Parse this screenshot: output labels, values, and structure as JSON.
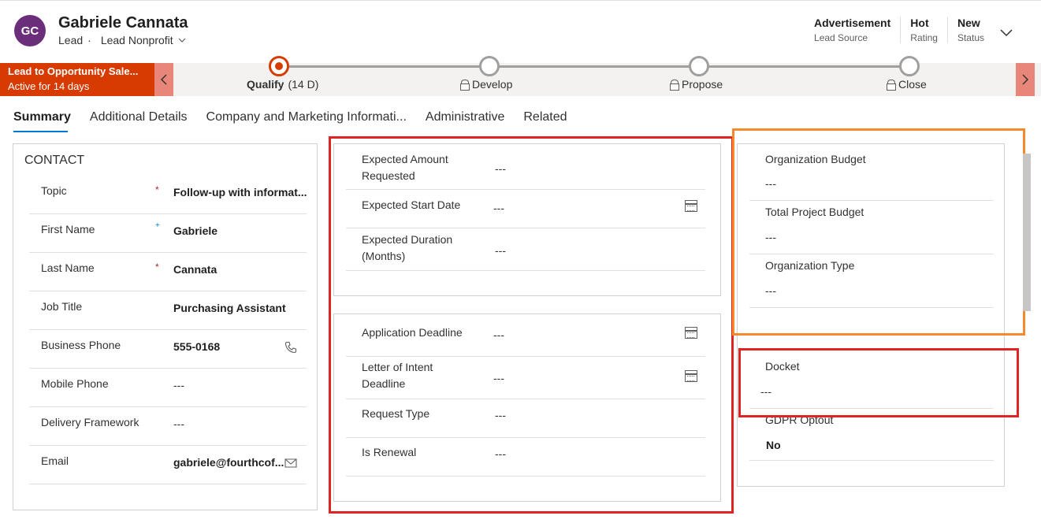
{
  "header": {
    "avatar_initials": "GC",
    "record_name": "Gabriele Cannata",
    "entity": "Lead",
    "separator": "·",
    "form_name": "Lead Nonprofit",
    "fields": [
      {
        "value": "Advertisement",
        "label": "Lead Source"
      },
      {
        "value": "Hot",
        "label": "Rating"
      },
      {
        "value": "New",
        "label": "Status"
      }
    ]
  },
  "bpf": {
    "process_name": "Lead to Opportunity Sale...",
    "active_for": "Active for 14 days",
    "stages": [
      {
        "label": "Qualify",
        "duration": "(14 D)",
        "active": true,
        "locked": false
      },
      {
        "label": "Develop",
        "active": false,
        "locked": true
      },
      {
        "label": "Propose",
        "active": false,
        "locked": true
      },
      {
        "label": "Close",
        "active": false,
        "locked": true
      }
    ],
    "accent_color": "#d83b01"
  },
  "tabs": [
    "Summary",
    "Additional Details",
    "Company and Marketing Informati...",
    "Administrative",
    "Related"
  ],
  "contact": {
    "title": "CONTACT",
    "fields": [
      {
        "label": "Topic",
        "value": "Follow-up with informat...",
        "required": "*"
      },
      {
        "label": "First Name",
        "value": "Gabriele",
        "required": "+"
      },
      {
        "label": "Last Name",
        "value": "Cannata",
        "required": "*"
      },
      {
        "label": "Job Title",
        "value": "Purchasing Assistant",
        "required": ""
      },
      {
        "label": "Business Phone",
        "value": "555-0168",
        "required": ""
      },
      {
        "label": "Mobile Phone",
        "value": "---",
        "required": ""
      },
      {
        "label": "Delivery Framework",
        "value": "---",
        "required": ""
      },
      {
        "label": "Email",
        "value": "gabriele@fourthcof...",
        "required": ""
      }
    ]
  },
  "funding": {
    "fields": [
      {
        "label": "Expected Amount Requested",
        "value": "---"
      },
      {
        "label": "Expected Start Date",
        "value": "---"
      },
      {
        "label": "Expected Duration (Months)",
        "value": "---"
      }
    ]
  },
  "application": {
    "fields": [
      {
        "label": "Application Deadline",
        "value": "---"
      },
      {
        "label": "Letter of Intent Deadline",
        "value": "---"
      },
      {
        "label": "Request Type",
        "value": "---"
      },
      {
        "label": "Is Renewal",
        "value": "---"
      }
    ]
  },
  "organization": {
    "fields": [
      {
        "label": "Organization Budget",
        "value": "---"
      },
      {
        "label": "Total Project Budget",
        "value": "---"
      },
      {
        "label": "Organization Type",
        "value": "---"
      }
    ]
  },
  "other": {
    "fields": [
      {
        "label": "Docket",
        "value": "---"
      },
      {
        "label": "GDPR Optout",
        "value": "No"
      }
    ]
  },
  "highlight_colors": {
    "red": "#e02323",
    "orange": "#f5892b"
  }
}
